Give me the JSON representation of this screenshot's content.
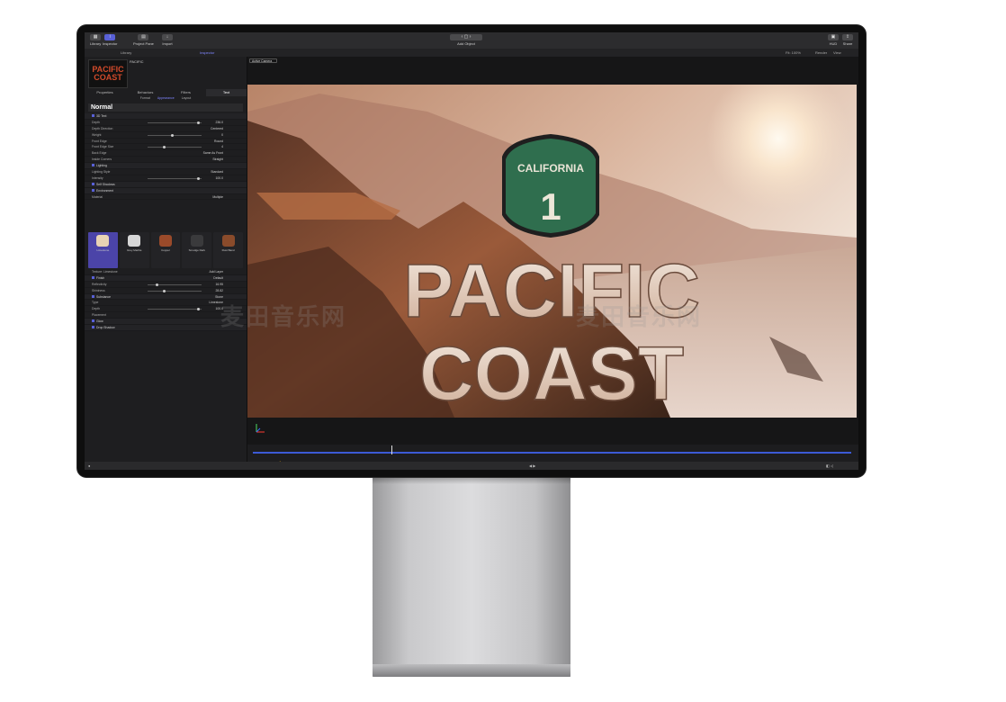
{
  "toolbar": {
    "left_buttons": [
      "Library",
      "Inspector",
      "Project Pane",
      "Import"
    ],
    "center_buttons": [
      "Add Object"
    ],
    "right_buttons": [
      "HUD",
      "Share"
    ],
    "tab_library": "Library",
    "tab_inspector": "Inspector",
    "fit": "Fit: 100%",
    "render": "Render",
    "view": "View"
  },
  "inspector": {
    "thumb_line1": "PACIFIC",
    "thumb_line2": "COAST",
    "title": "PACIFIC",
    "tabs": [
      "Properties",
      "Behaviors",
      "Filters",
      "Text"
    ],
    "subtabs": [
      "Format",
      "Appearance",
      "Layout"
    ],
    "preset": "Normal",
    "rows": [
      {
        "label": "3D Text",
        "value": "",
        "head": true
      },
      {
        "label": "Depth",
        "value": "236.0",
        "slider": 0.95
      },
      {
        "label": "Depth Direction",
        "value": "Centered"
      },
      {
        "label": "Weight",
        "value": "0",
        "slider": 0.45
      },
      {
        "label": "Front Edge",
        "value": "Round"
      },
      {
        "label": "Front Edge Size",
        "value": "4",
        "slider": 0.3
      },
      {
        "label": "Back Edge",
        "value": "Same As Front"
      },
      {
        "label": "Inside Corners",
        "value": "Straight"
      },
      {
        "label": "Lighting",
        "value": "",
        "head": true
      },
      {
        "label": "Lighting Style",
        "value": "Standard"
      },
      {
        "label": "Intensity",
        "value": "100.0",
        "slider": 0.95
      },
      {
        "label": "Self Shadows",
        "value": "",
        "head": true
      },
      {
        "label": "Environment",
        "value": "",
        "head": true
      },
      {
        "label": "Material",
        "value": "Multiple"
      }
    ],
    "materials": [
      {
        "name": "Limestone",
        "color": "#e8d3b4"
      },
      {
        "name": "Grey Marble",
        "color": "#d7d7d7"
      },
      {
        "name": "Copper",
        "color": "#9a4a2a"
      },
      {
        "name": "Smudge Dark",
        "color": "#3a3a3c"
      },
      {
        "name": "Rust Band",
        "color": "#8a4b2b"
      }
    ],
    "rows2": [
      {
        "label": "Texture: Limestone",
        "value": "Add Layer"
      },
      {
        "label": "Finish",
        "value": "Default",
        "head": true
      },
      {
        "label": "Reflectivity",
        "value": "16.95",
        "slider": 0.15
      },
      {
        "label": "Shininess",
        "value": "28.82",
        "slider": 0.3
      },
      {
        "label": "Substance",
        "value": "Stone",
        "head": true
      },
      {
        "label": "Type",
        "value": "Limestone"
      },
      {
        "label": "Depth",
        "value": "100.0",
        "slider": 0.95
      },
      {
        "label": "Placement",
        "value": ""
      },
      {
        "label": "Glow",
        "value": "",
        "head": true
      },
      {
        "label": "Drop Shadow",
        "value": "",
        "head": true
      }
    ]
  },
  "viewer": {
    "camera": "Active Camera",
    "sign_state": "CALIFORNIA",
    "sign_number": "1",
    "title_line1": "PACIFIC",
    "title_line2": "COAST"
  },
  "watermark": "麦田音乐网"
}
